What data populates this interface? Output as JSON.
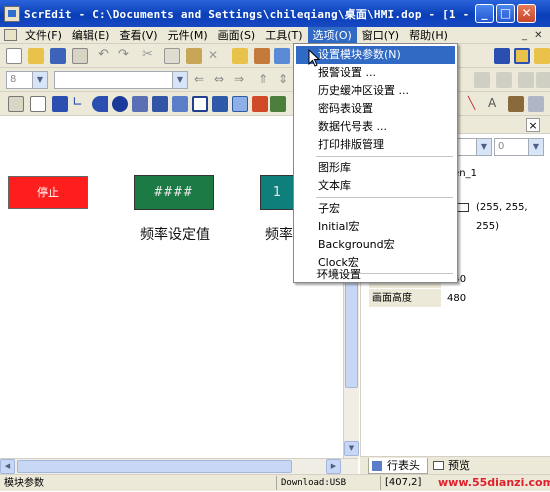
{
  "window": {
    "title": "ScrEdit - C:\\Documents and Settings\\chileqiang\\桌面\\HMI.dop - [1 - ...",
    "minimize": "_",
    "maximize": "□",
    "close": "✕"
  },
  "menubar": {
    "items": [
      "文件(F)",
      "编辑(E)",
      "查看(V)",
      "元件(M)",
      "画面(S)",
      "工具(T)",
      "选项(O)",
      "窗口(Y)",
      "帮助(H)"
    ],
    "active_index": 6
  },
  "toolbar": {
    "combo1_value": "8",
    "combo2_value": ""
  },
  "options_menu": {
    "items": [
      "设置模块参数(N)",
      "报警设置 ...",
      "历史缓冲区设置 ...",
      "密码表设置",
      "数据代号表 ...",
      "打印排版管理",
      "图形库",
      "文本库",
      "子宏",
      "Initial宏",
      "Background宏",
      "Clock宏",
      "环境设置"
    ],
    "highlighted_index": 0
  },
  "canvas": {
    "stop_button_label": "停止",
    "display1_value": "####",
    "display2_value": "1",
    "label1": "频率设定值",
    "label2": "频率"
  },
  "properties": {
    "close": "×",
    "combo_value": "0",
    "rows": [
      {
        "key": "",
        "value": "een_1"
      },
      {
        "key": "",
        "value": "ail"
      },
      {
        "key": "",
        "value": "(255, 255, 255)"
      },
      {
        "key": "画面宽度",
        "value": "640"
      },
      {
        "key": "画面高度",
        "value": "480"
      }
    ],
    "tabs": [
      "行表头",
      "预览"
    ]
  },
  "statusbar": {
    "text": "模块参数",
    "download": "Download:USB",
    "coords": "[407,2]",
    "watermark": "www.55dianzi.com"
  },
  "colors": {
    "title_blue": "#0a3fb8",
    "menu_highlight": "#316ac5",
    "stop_red": "#ff1e1e",
    "display_green": "#1c7a45",
    "display_teal": "#0e7f7a",
    "watermark_red": "#e0202a"
  }
}
